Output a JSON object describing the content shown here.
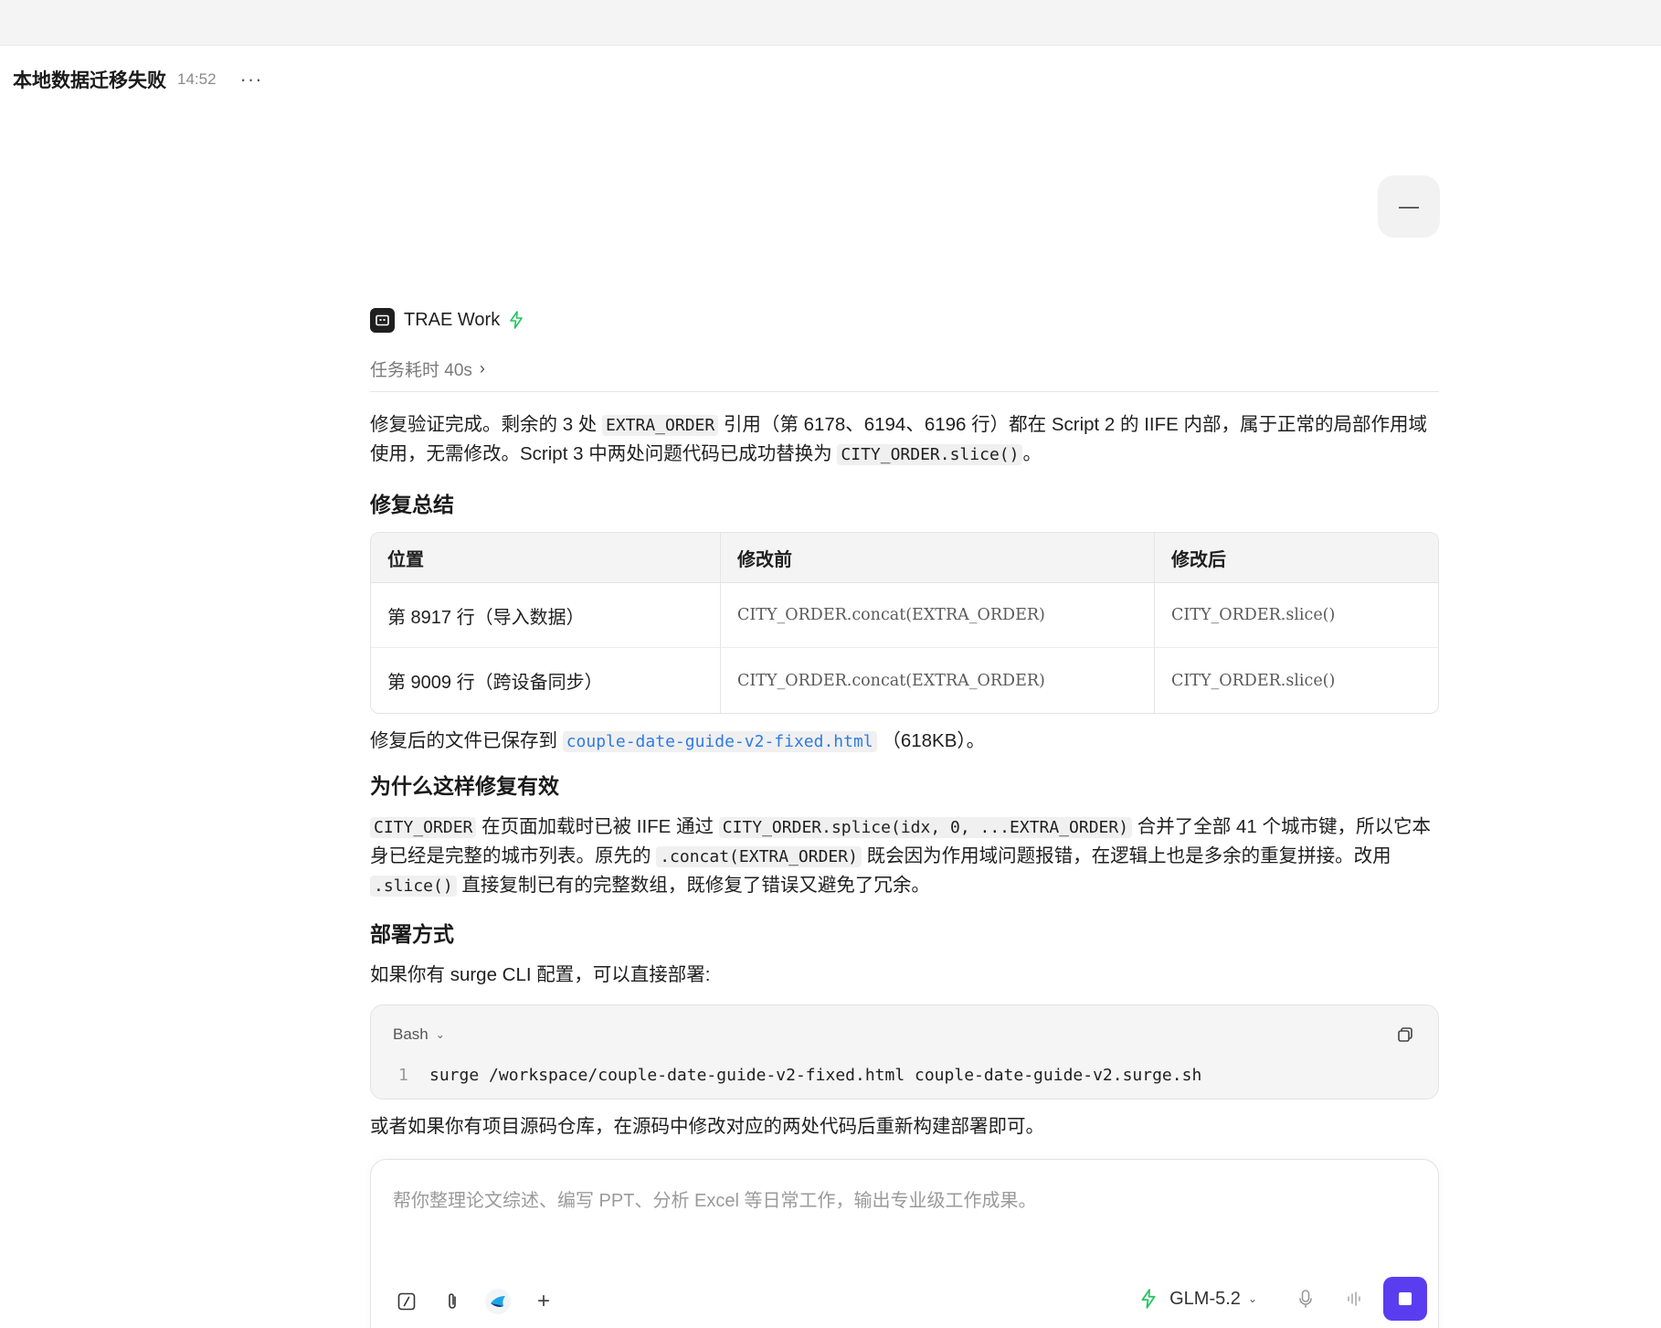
{
  "header": {
    "title": "本地数据迁移失败",
    "time": "14:52",
    "more_icon": "···"
  },
  "user_message": {
    "text": "—"
  },
  "agent": {
    "name": "TRAE Work",
    "duration": "任务耗时 40s"
  },
  "intro": {
    "t1": "修复验证完成。剩余的 3 处 ",
    "c1": "EXTRA_ORDER",
    "t2": " 引用（第 6178、6194、6196 行）都在 Script 2 的 IIFE 内部，属于正常的局部作用域使用，无需修改。Script 3 中两处问题代码已成功替换为 ",
    "c2": "CITY_ORDER.slice()",
    "t3": "。"
  },
  "summary": {
    "heading": "修复总结",
    "columns": [
      "位置",
      "修改前",
      "修改后"
    ],
    "rows": [
      [
        "第 8917 行（导入数据）",
        "CITY_ORDER.concat(EXTRA_ORDER)",
        "CITY_ORDER.slice()"
      ],
      [
        "第 9009 行（跨设备同步）",
        "CITY_ORDER.concat(EXTRA_ORDER)",
        "CITY_ORDER.slice()"
      ]
    ]
  },
  "saved": {
    "t1": "修复后的文件已保存到 ",
    "file": "couple-date-guide-v2-fixed.html",
    "t2": " （618KB）。"
  },
  "why": {
    "heading": "为什么这样修复有效",
    "c1": "CITY_ORDER",
    "t1": " 在页面加载时已被 IIFE 通过 ",
    "c2": "CITY_ORDER.splice(idx, 0, ...EXTRA_ORDER)",
    "t2": " 合并了全部 41 个城市键，所以它本身已经是完整的城市列表。原先的 ",
    "c3": ".concat(EXTRA_ORDER)",
    "t3": " 既会因为作用域问题报错，在逻辑上也是多余的重复拼接。改用 ",
    "c4": ".slice()",
    "t4": " 直接复制已有的完整数组，既修复了错误又避免了冗余。"
  },
  "deploy": {
    "heading": "部署方式",
    "intro": "如果你有 surge CLI 配置，可以直接部署:",
    "code_lang": "Bash",
    "line_no": "1",
    "code": "surge /workspace/couple-date-guide-v2-fixed.html couple-date-guide-v2.surge.sh",
    "outro": "或者如果你有项目源码仓库，在源码中修改对应的两处代码后重新构建部署即可。"
  },
  "composer": {
    "placeholder": "帮你整理论文综述、编写 PPT、分析 Excel 等日常工作，输出专业级工作成果。",
    "plus": "+",
    "model": "GLM-5.2"
  },
  "colors": {
    "accent": "#5b3df0",
    "bolt": "#22c55e",
    "link": "#2f7be5"
  }
}
